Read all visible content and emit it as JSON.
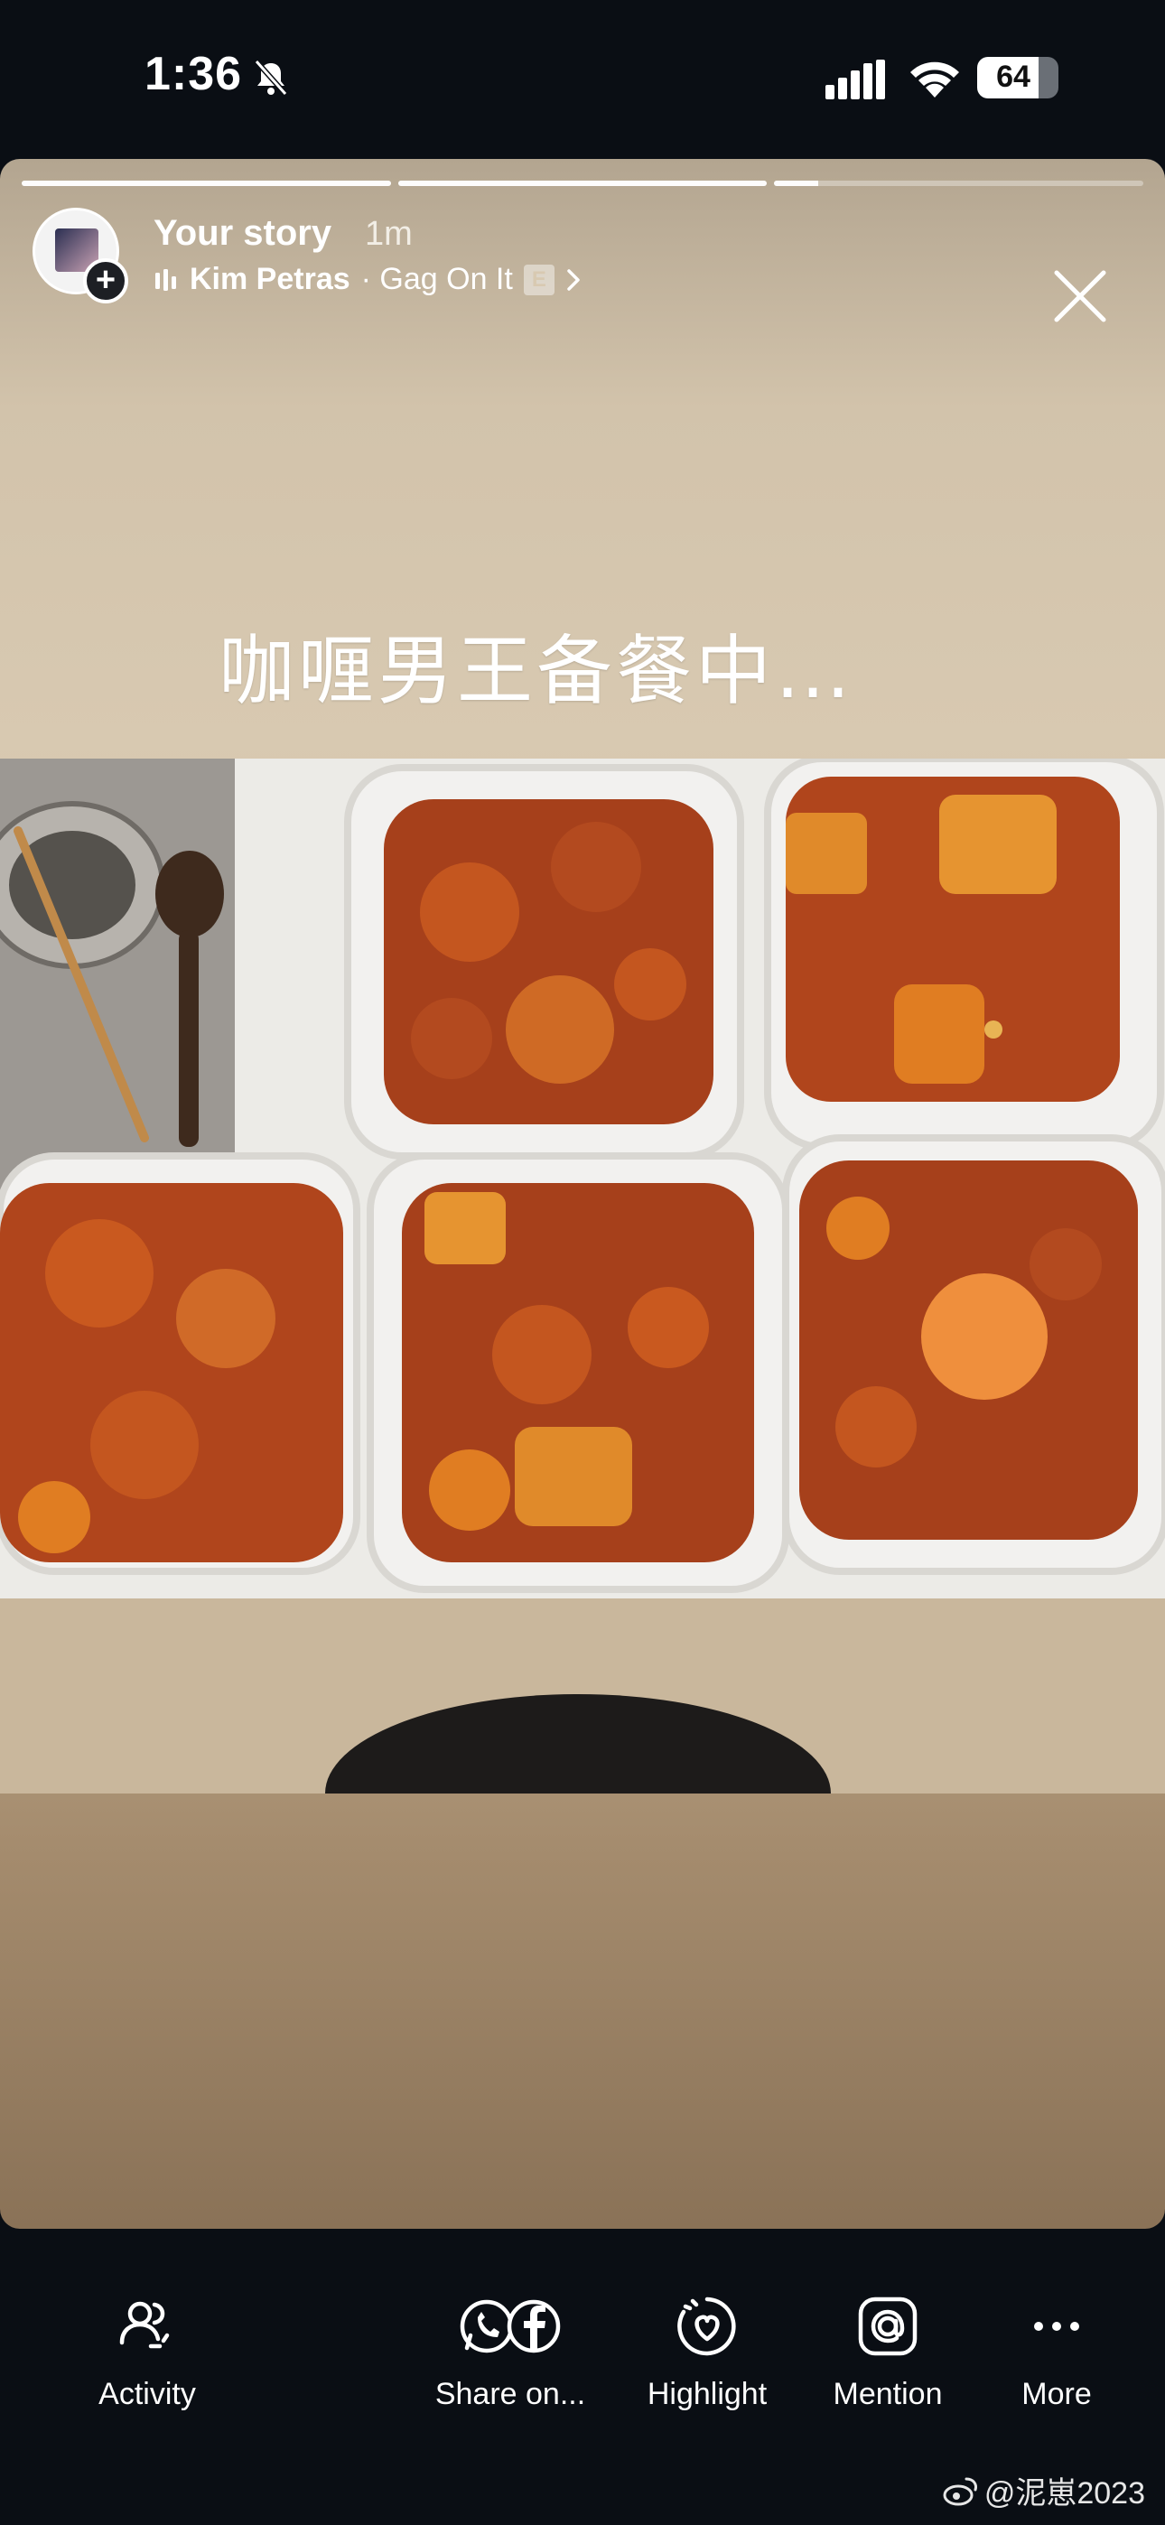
{
  "status_bar": {
    "time": "1:36",
    "battery": "64"
  },
  "story": {
    "progress": [
      1.0,
      1.0,
      0.12
    ],
    "title": "Your story",
    "time_ago": "1m",
    "artist": "Kim Petras",
    "song": "· Gag On It",
    "explicit": "E",
    "caption": "咖喱男王备餐中…"
  },
  "actions": {
    "activity": "Activity",
    "share": "Share on...",
    "highlight": "Highlight",
    "mention": "Mention",
    "more": "More"
  },
  "watermark": "@泥崽2023"
}
